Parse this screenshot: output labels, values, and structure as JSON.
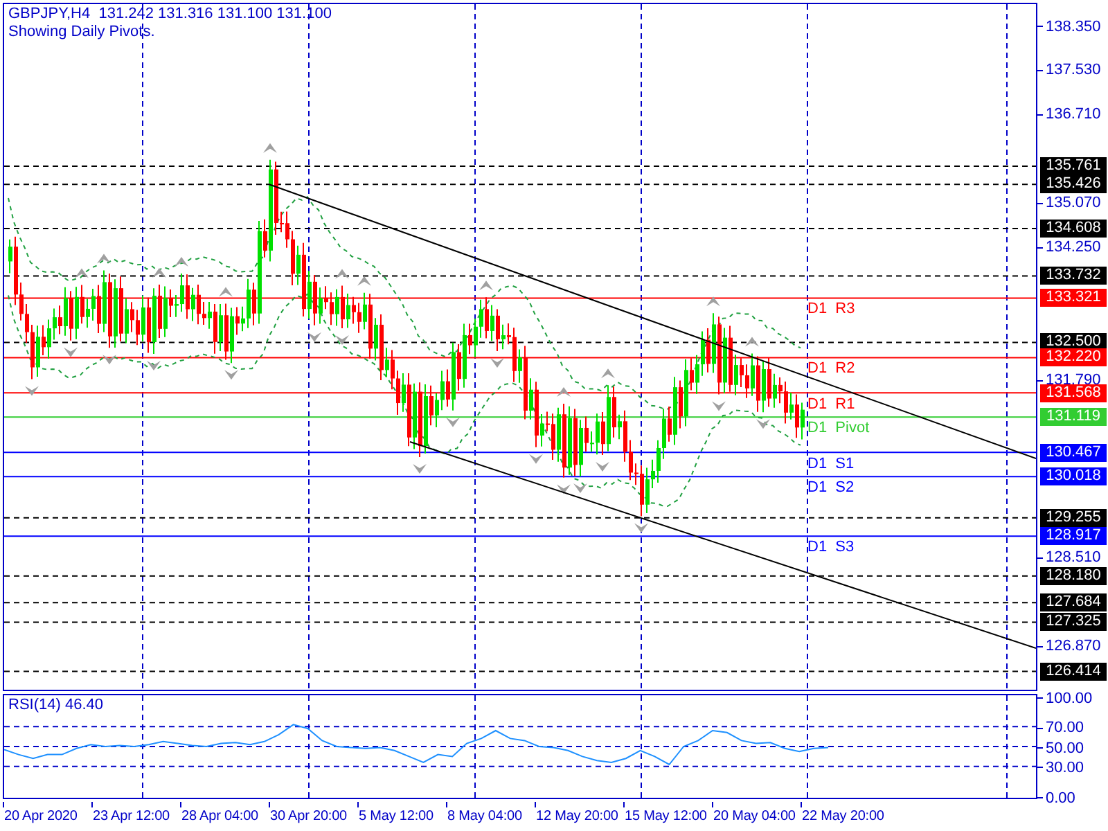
{
  "header": {
    "quote_line": "GBPJPY,H4  131.242 131.316 131.100 131.100",
    "note": "Showing Daily Pivots."
  },
  "price_axis": {
    "ticks": [
      "138.350",
      "137.530",
      "136.710",
      "135.070",
      "134.250",
      "131.790",
      "128.510",
      "126.870"
    ]
  },
  "levels": [
    {
      "kind": "line",
      "price": "135.761",
      "color": "#000000"
    },
    {
      "kind": "line",
      "price": "135.426",
      "color": "#000000"
    },
    {
      "kind": "line",
      "price": "134.608",
      "color": "#000000"
    },
    {
      "kind": "line",
      "price": "133.732",
      "color": "#000000"
    },
    {
      "kind": "pivot",
      "price": "133.321",
      "color": "#ff0000",
      "label": "D1  R3"
    },
    {
      "kind": "line",
      "price": "132.500",
      "color": "#000000"
    },
    {
      "kind": "pivot",
      "price": "132.220",
      "color": "#ff0000",
      "label": "D1  R2"
    },
    {
      "kind": "pivot",
      "price": "131.568",
      "color": "#ff0000",
      "label": "D1  R1"
    },
    {
      "kind": "pivot",
      "price": "131.119",
      "color": "#32cd32",
      "label": "D1  Pivot"
    },
    {
      "kind": "pivot",
      "price": "130.467",
      "color": "#0000ff",
      "label": "D1  S1"
    },
    {
      "kind": "pivot",
      "price": "130.018",
      "color": "#0000ff",
      "label": "D1  S2"
    },
    {
      "kind": "line",
      "price": "129.255",
      "color": "#000000"
    },
    {
      "kind": "pivot",
      "price": "128.917",
      "color": "#0000ff",
      "label": "D1  S3"
    },
    {
      "kind": "line",
      "price": "128.180",
      "color": "#000000"
    },
    {
      "kind": "line",
      "price": "127.684",
      "color": "#000000"
    },
    {
      "kind": "line",
      "price": "127.325",
      "color": "#000000"
    },
    {
      "kind": "line",
      "price": "126.414",
      "color": "#000000"
    }
  ],
  "rsi": {
    "chart_data": {
      "type": "line",
      "title": "RSI(14) 46.40",
      "ylim": [
        0,
        100
      ],
      "grid": true,
      "yticks": [
        {
          "value": 100,
          "label": "100.00"
        },
        {
          "value": 70,
          "label": "70.00"
        },
        {
          "value": 50,
          "label": "50.00"
        },
        {
          "value": 30,
          "label": "30.00"
        },
        {
          "value": 0,
          "label": "0.00"
        }
      ],
      "series": [
        {
          "color": "#1e90ff",
          "values": [
            47,
            42,
            38,
            42,
            42,
            48,
            52,
            50,
            51,
            50,
            52,
            55,
            53,
            51,
            50,
            53,
            54,
            52,
            55,
            62,
            72,
            68,
            56,
            50,
            49,
            48,
            49,
            46,
            40,
            34,
            42,
            40,
            53,
            58,
            66,
            58,
            56,
            50,
            49,
            46,
            40,
            36,
            34,
            38,
            46,
            40,
            32,
            50,
            56,
            66,
            64,
            56,
            53,
            54,
            48,
            45,
            48,
            49
          ]
        }
      ]
    }
  },
  "time_axis": {
    "labels": [
      "20 Apr 2020",
      "23 Apr 12:00",
      "28 Apr 04:00",
      "30 Apr 20:00",
      "5 May 12:00",
      "8 May 04:00",
      "12 May 20:00",
      "15 May 12:00",
      "20 May 04:00",
      "22 May 20:00"
    ]
  }
}
